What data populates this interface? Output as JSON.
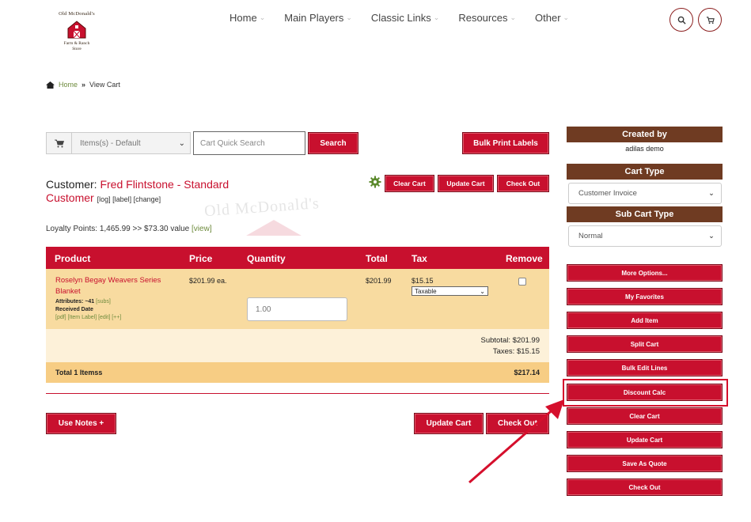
{
  "logo": {
    "top": "Old McDonald's",
    "bottom_line1": "Farm & Ranch",
    "bottom_line2": "Store"
  },
  "nav": [
    {
      "label": "Home"
    },
    {
      "label": "Main Players"
    },
    {
      "label": "Classic Links"
    },
    {
      "label": "Resources"
    },
    {
      "label": "Other"
    }
  ],
  "breadcrumb": {
    "home": "Home",
    "separator": "»",
    "current": "View Cart"
  },
  "toolbar": {
    "cart_select_value": "Items(s) - Default",
    "quick_search_placeholder": "Cart Quick Search",
    "search_label": "Search",
    "bulk_print_label": "Bulk Print Labels"
  },
  "customer": {
    "label": "Customer:",
    "name": "Fred Flintstone - Standard Customer",
    "links": "[log] [label] [change]"
  },
  "top_actions": {
    "clear": "Clear Cart",
    "update": "Update Cart",
    "checkout": "Check Out"
  },
  "watermark": "Old McDonald's",
  "loyalty": {
    "text": "Loyalty Points: 1,465.99 >> $73.30 value",
    "link": "[view]"
  },
  "table": {
    "headers": {
      "product": "Product",
      "price": "Price",
      "quantity": "Quantity",
      "total": "Total",
      "tax": "Tax",
      "remove": "Remove"
    },
    "row": {
      "product": "Roselyn Begay Weavers Series Blanket",
      "attributes": "Attributes: ~41",
      "attributes_link": "[subs]",
      "received": "Received Date",
      "links": "[pdf] [Item Label] [edit] [++]",
      "price": "$201.99 ea.",
      "quantity": "1.00",
      "total": "$201.99",
      "tax_amount": "$15.15",
      "tax_option": "Taxable"
    },
    "subtotal": "Subtotal: $201.99",
    "taxes": "Taxes: $15.15",
    "total_label": "Total 1 Itemss",
    "total_value": "$217.14"
  },
  "bottom_actions": {
    "use_notes": "Use Notes +",
    "update": "Update Cart",
    "checkout": "Check Out"
  },
  "sidebar": {
    "created_by_label": "Created by",
    "created_by_value": "adilas demo",
    "cart_type_label": "Cart Type",
    "cart_type_value": "Customer Invoice",
    "sub_cart_type_label": "Sub Cart Type",
    "sub_cart_type_value": "Normal",
    "buttons": [
      "More Options...",
      "My Favorites",
      "Add Item",
      "Split Cart",
      "Bulk Edit Lines",
      "Discount Calc",
      "Clear Cart",
      "Update Cart",
      "Save As Quote",
      "Check Out"
    ]
  },
  "colors": {
    "brand_red": "#c8102e",
    "brown": "#6f3b22",
    "row_bg": "#f8dba0",
    "link_green": "#6e8b3d",
    "highlight": "#d50f2c"
  },
  "icons": [
    "barn-logo",
    "search-icon",
    "cart-icon",
    "home-icon",
    "gear-icon",
    "arrow-annotation"
  ]
}
